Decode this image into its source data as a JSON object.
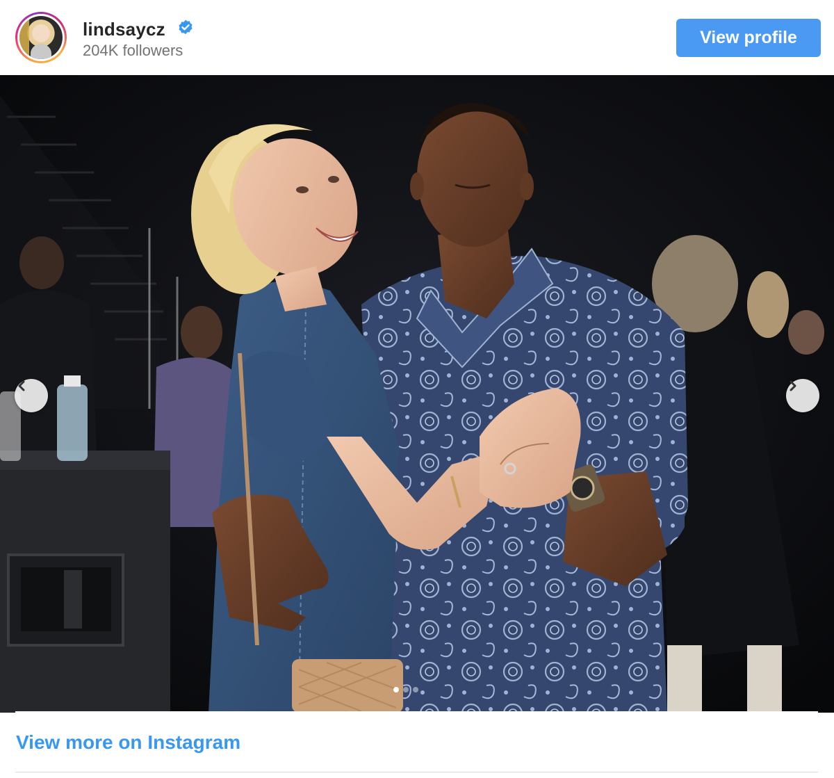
{
  "header": {
    "username": "lindsaycz",
    "followers": "204K followers",
    "view_profile_label": "View profile"
  },
  "post": {
    "carousel": {
      "slide_count": 3,
      "active_slide": 1
    }
  },
  "footer": {
    "view_more_label": "View more on Instagram"
  },
  "icons": {
    "verified": "verified-badge-icon",
    "prev": "chevron-left-icon",
    "next": "chevron-right-icon"
  },
  "colors": {
    "accent": "#4a9af3",
    "link": "#3897f0",
    "verified": "#3897f0"
  }
}
